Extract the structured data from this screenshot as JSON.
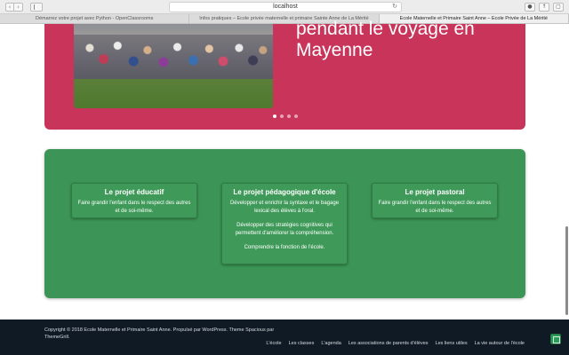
{
  "browser": {
    "address": "localhost",
    "tabs": [
      {
        "label": "Démarrez votre projet avec Python - OpenClassrooms",
        "active": false
      },
      {
        "label": "Infos pratiques – Ecole privée maternelle et primaire Sainte Anne de La Mérité",
        "active": false
      },
      {
        "label": "Ecole Maternelle et Primaire Saint Anne – Ecole Privée de La Mérité",
        "active": true
      }
    ]
  },
  "slider": {
    "caption": "pendant le voyage en Mayenne",
    "dot_count": 4,
    "active_dot": 1
  },
  "projects": [
    {
      "title": "Le projet éducatif",
      "paragraphs": [
        "Faire grandir l'enfant dans le respect des autres et de soi-même."
      ]
    },
    {
      "title": "Le projet pédagogique d'école",
      "paragraphs": [
        "Développer et enrichir la syntaxe et le bagage lexical des élèves à l'oral.",
        "Développer des stratégies cognitives qui permettent d'améliorer la compréhension.",
        "Comprendre la fonction de l'école."
      ]
    },
    {
      "title": "Le projet pastoral",
      "paragraphs": [
        "Faire grandir l'enfant dans le respect des autres et de soi-même."
      ]
    }
  ],
  "footer": {
    "copyright": "Copyright © 2018  Ecole Maternelle et Primaire Saint Anne. Propulsé par  WordPress. Theme Spacious par ThemeGrill.",
    "links": [
      "L'école",
      "Les classes",
      "L'agenda",
      "Les associations de parents d'élèves",
      "Les liens utiles",
      "La vie autour de l'école"
    ]
  },
  "colors": {
    "slider_bg": "#c8345a",
    "projects_bg": "#3c9556",
    "footer_bg": "#0f1a24"
  }
}
